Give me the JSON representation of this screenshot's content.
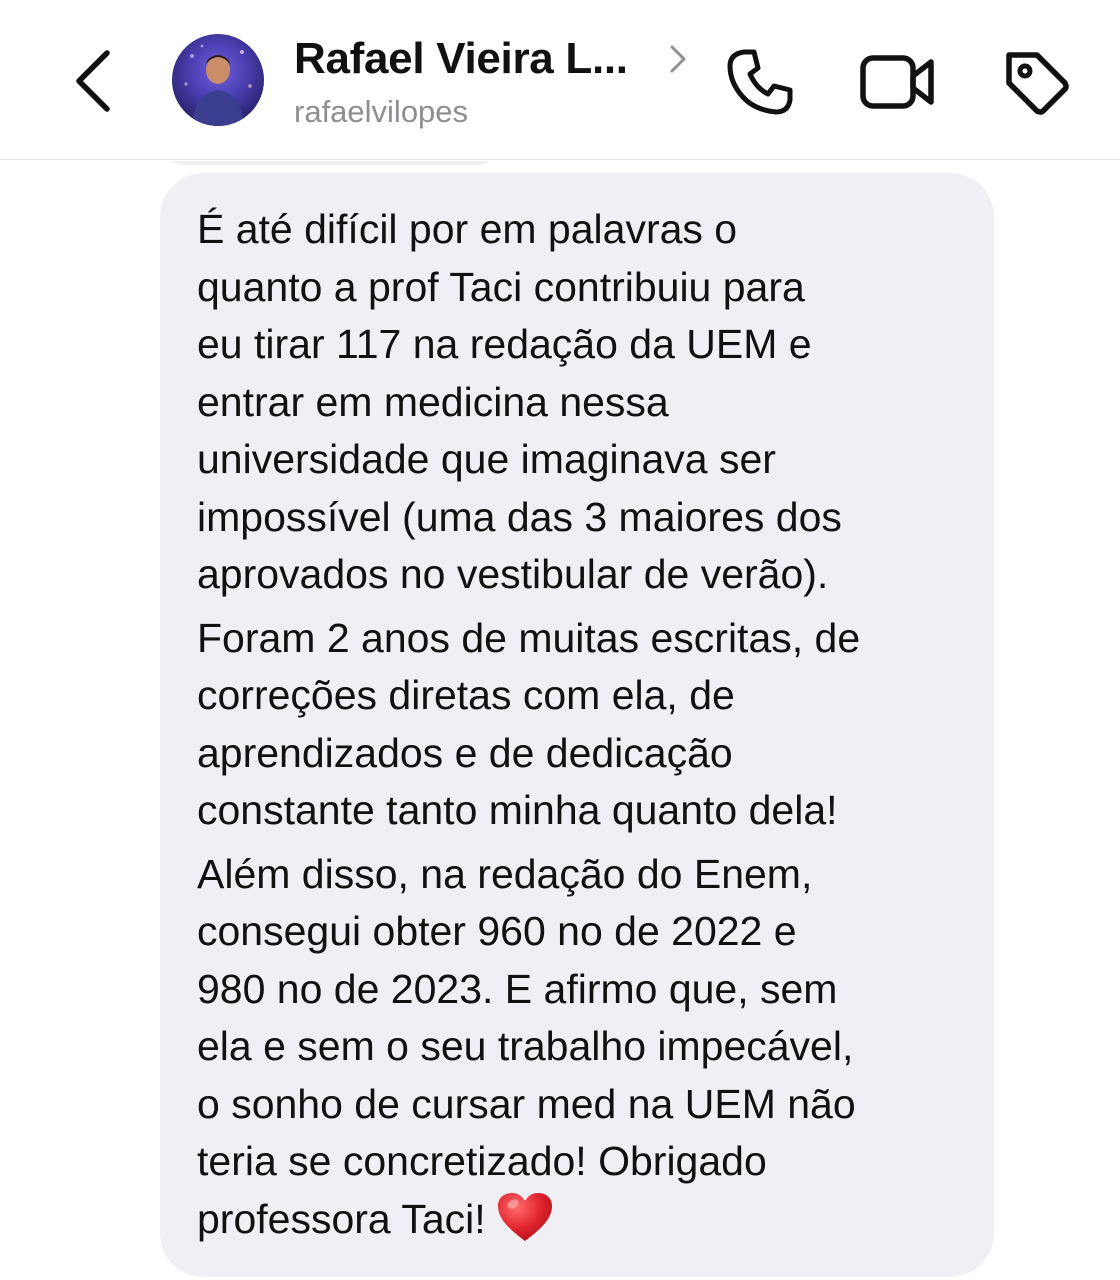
{
  "header": {
    "name": "Rafael Vieira L...",
    "username": "rafaelvilopes",
    "icons": {
      "back": "chevron-left-icon",
      "name_chevron": "chevron-right-icon",
      "call": "phone-icon",
      "video": "video-camera-icon",
      "tag": "tag-icon"
    }
  },
  "message": {
    "paragraphs": [
      [
        "É até difícil por em palavras o",
        "quanto a prof Taci contribuiu para",
        "eu tirar 117 na redação da UEM e",
        "entrar em medicina nessa",
        "universidade que imaginava ser",
        "impossível (uma das 3 maiores dos",
        "aprovados no vestibular de verão)."
      ],
      [
        "Foram 2 anos de muitas escritas, de",
        "correções diretas com ela, de",
        "aprendizados e de dedicação",
        "constante tanto minha quanto dela!"
      ],
      [
        "Além disso, na redação do Enem,",
        "consegui obter 960 no de 2022 e",
        "980 no de 2023. E afirmo que, sem",
        "ela e sem o seu trabalho impecável,",
        "o sonho de cursar med na UEM não",
        "teria se concretizado! Obrigado",
        "professora Taci!"
      ]
    ],
    "emoji": "heart-emoji"
  },
  "colors": {
    "bubble": "#efeff4",
    "text": "#111111",
    "username": "#8e8e93",
    "heart": "#e0242e"
  }
}
